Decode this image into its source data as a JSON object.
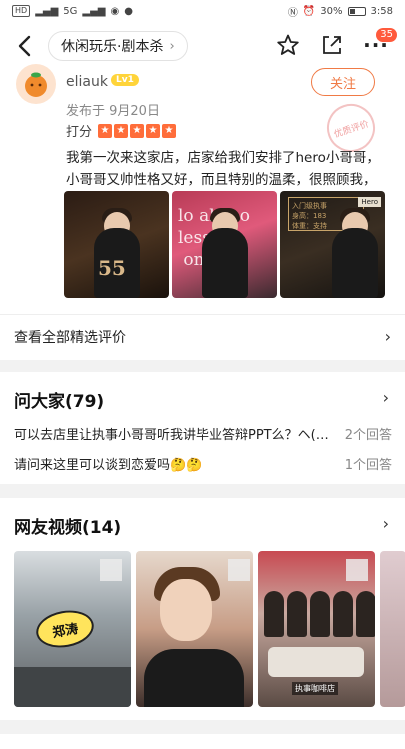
{
  "status_bar": {
    "left_items": [
      "HD",
      "26",
      "5G"
    ],
    "battery": "30%",
    "time": "3:58"
  },
  "nav": {
    "breadcrumb": "休闲玩乐·剧本杀",
    "cart_badge": "35"
  },
  "review": {
    "username": "eliauk",
    "level": "Lv1",
    "follow_label": "关注",
    "stamp_text": "优质评价",
    "posted": "发布于 9月20日",
    "rating_label": "打分",
    "stars": 5,
    "text": "我第一次来这家店，店家给我们安排了hero小哥哥，小哥哥又帅性格又好，而且特别的温柔，很照顾我，说...",
    "photo_texts": {
      "photo1_number": "55",
      "photo2_neon": "lo als no\nless\n oml",
      "photo3_sign": "入门级执事",
      "photo3_sign_lines": "身高：183\n体重：支持",
      "photo3_tag": "Hero"
    },
    "see_all_label": "查看全部精选评价"
  },
  "qa": {
    "title": "问大家(79)",
    "items": [
      {
        "question": "可以去店里让执事小哥哥听我讲毕业答辩PPT么？ヘ(…",
        "answers": "2个回答"
      },
      {
        "question": "请问来这里可以谈到恋爱吗🤔🤔",
        "answers": "1个回答"
      }
    ]
  },
  "videos": {
    "title": "网友视频(14)",
    "items": [
      {
        "sticker": "郑涛"
      },
      {
        "sticker": ""
      },
      {
        "caption": "执事咖啡店"
      }
    ]
  }
}
